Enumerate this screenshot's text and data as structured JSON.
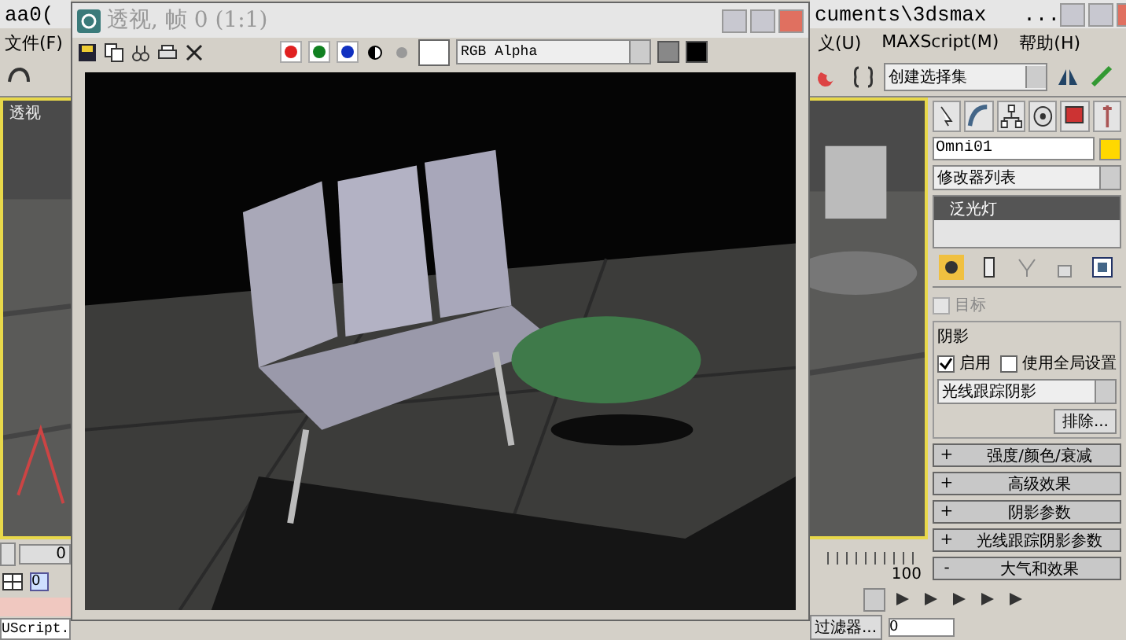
{
  "main_window": {
    "title_left": "aa0(",
    "title_right": "cuments\\3dsmax   ...",
    "menus": [
      {
        "label": "文件(F)"
      },
      {
        "label": "义(U)"
      },
      {
        "label": "MAXScript(M)"
      },
      {
        "label": "帮助(H)"
      }
    ],
    "selection_set": "创建选择集",
    "viewport_label": "透视"
  },
  "render_window": {
    "title": "透视, 帧 0 (1:1)",
    "channels": [
      {
        "kind": "red",
        "on": true
      },
      {
        "kind": "green",
        "on": true
      },
      {
        "kind": "blue",
        "on": true
      }
    ],
    "channel_select": "RGB Alpha"
  },
  "command_panel": {
    "object_name": "Omni01",
    "modifier_list": "修改器列表",
    "stack": [
      {
        "label": "泛光灯",
        "selected": true
      }
    ],
    "target": {
      "label": "目标",
      "checked": false,
      "disabled": true
    },
    "shadows": {
      "title": "阴影",
      "options": [
        {
          "label": "启用",
          "checked": true
        },
        {
          "label": "使用全局设置",
          "checked": false
        }
      ],
      "type": "光线跟踪阴影",
      "exclude": "排除..."
    },
    "rollouts": [
      {
        "sign": "+",
        "label": "强度/颜色/衰减"
      },
      {
        "sign": "+",
        "label": "高级效果"
      },
      {
        "sign": "+",
        "label": "阴影参数"
      },
      {
        "sign": "+",
        "label": "光线跟踪阴影参数"
      },
      {
        "sign": "-",
        "label": "大气和效果"
      }
    ]
  },
  "timeline": {
    "start": "0",
    "end": "100"
  },
  "status": {
    "frame_field": "0",
    "script_field": "UScript.",
    "key_filter": "过滤器...",
    "current_frame": "0"
  }
}
